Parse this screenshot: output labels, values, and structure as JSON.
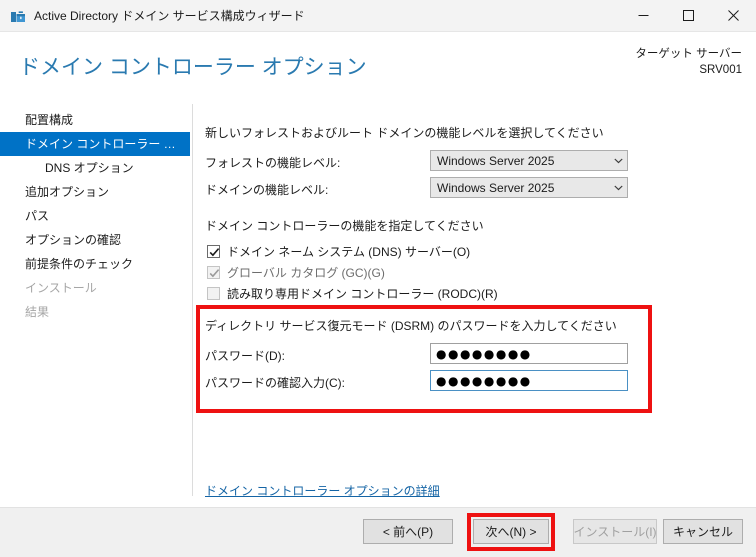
{
  "window": {
    "title": "Active Directory ドメイン サービス構成ウィザード",
    "icon": "server-manager-icon",
    "controls": {
      "minimize": "minimize-icon",
      "maximize": "maximize-icon",
      "close": "close-icon"
    }
  },
  "header": {
    "page_title": "ドメイン コントローラー オプション",
    "target_server_label": "ターゲット サーバー",
    "target_server_value": "SRV001"
  },
  "sidebar": {
    "items": [
      {
        "label": "配置構成",
        "state": "normal",
        "indent": false
      },
      {
        "label": "ドメイン コントローラー オプシ...",
        "state": "selected",
        "indent": false
      },
      {
        "label": "DNS オプション",
        "state": "normal",
        "indent": true
      },
      {
        "label": "追加オプション",
        "state": "normal",
        "indent": false
      },
      {
        "label": "パス",
        "state": "normal",
        "indent": false
      },
      {
        "label": "オプションの確認",
        "state": "normal",
        "indent": false
      },
      {
        "label": "前提条件のチェック",
        "state": "normal",
        "indent": false
      },
      {
        "label": "インストール",
        "state": "disabled",
        "indent": false
      },
      {
        "label": "結果",
        "state": "disabled",
        "indent": false
      }
    ]
  },
  "main": {
    "functional_level": {
      "heading": "新しいフォレストおよびルート ドメインの機能レベルを選択してください",
      "forest_label": "フォレストの機能レベル:",
      "forest_value": "Windows Server 2025",
      "domain_label": "ドメインの機能レベル:",
      "domain_value": "Windows Server 2025"
    },
    "capabilities": {
      "heading": "ドメイン コントローラーの機能を指定してください",
      "items": [
        {
          "label": "ドメイン ネーム システム (DNS) サーバー(O)",
          "checked": true,
          "disabled": false
        },
        {
          "label": "グローバル カタログ (GC)(G)",
          "checked": true,
          "disabled": true
        },
        {
          "label": "読み取り専用ドメイン コントローラー (RODC)(R)",
          "checked": false,
          "disabled": true
        }
      ]
    },
    "dsrm": {
      "heading": "ディレクトリ サービス復元モード (DSRM) のパスワードを入力してください",
      "password_label": "パスワード(D):",
      "password_value": "●●●●●●●●",
      "confirm_label": "パスワードの確認入力(C):",
      "confirm_value": "●●●●●●●●"
    },
    "details_link": "ドメイン コントローラー オプションの詳細"
  },
  "footer": {
    "back": "< 前へ(P)",
    "next": "次へ(N) >",
    "install": "インストール(I)",
    "cancel": "キャンセル"
  },
  "annotations": {
    "accent_red": "#ee1111",
    "accent_blue": "#0072c6",
    "title_blue": "#2a7ab0"
  }
}
